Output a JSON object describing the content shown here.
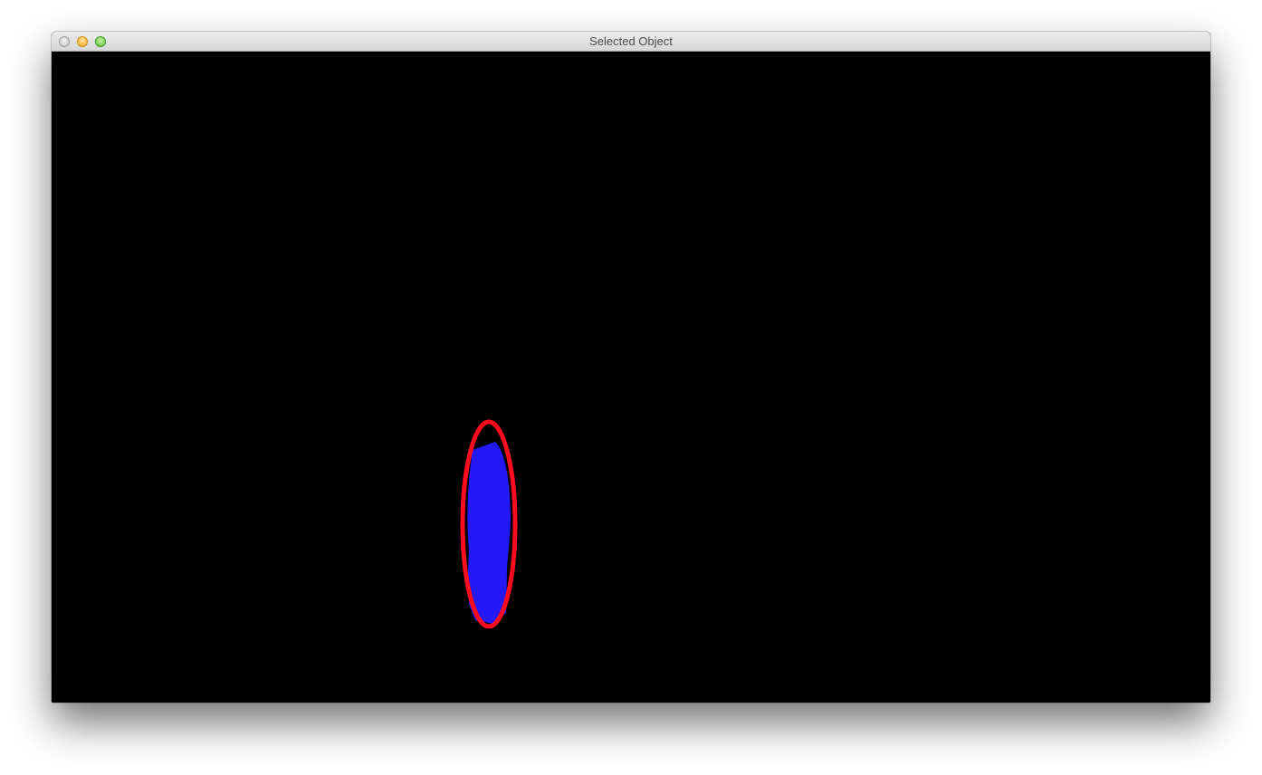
{
  "window": {
    "title": "Selected Object",
    "buttons": {
      "close": "close-icon",
      "minimize": "minimize-icon",
      "zoom": "zoom-icon"
    }
  },
  "canvas": {
    "background": "#000000",
    "object_color": "#2219f5",
    "highlight_color": "#ff0a1e"
  }
}
